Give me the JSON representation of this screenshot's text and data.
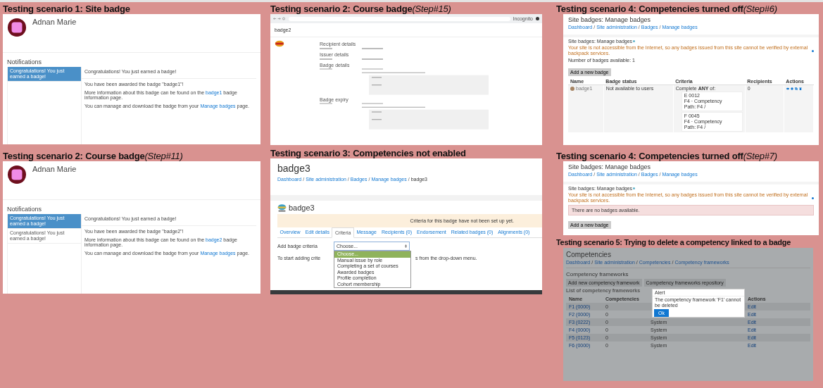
{
  "columns": [
    [
      {
        "kind": "notifications",
        "title": "Testing scenario 1: Site badge",
        "screen": {
          "user_name": "Adnan Marie",
          "heading": "Notifications",
          "items": [
            {
              "text": "Congratulations! You just earned a badge!",
              "selected": true
            }
          ],
          "subject": "Congratulations! You just earned a badge!",
          "paragraphs": [
            {
              "text": "You have been awarded the badge \"badge1\"!"
            },
            {
              "text": "More information about this badge can be found on the ",
              "link": "badge1",
              "after": " badge information page."
            },
            {
              "text": "You can manage and download the badge from your ",
              "link": "Manage badges",
              "after": " page."
            }
          ]
        }
      },
      {
        "kind": "notifications",
        "title": "Testing scenario 2: Course badge",
        "step": "(Step#11)",
        "screen": {
          "user_name": "Adnan Marie",
          "heading": "Notifications",
          "items": [
            {
              "text": "Congratulations! You just earned a badge!",
              "selected": true
            },
            {
              "text": "Congratulations! You just earned a badge!",
              "selected": false
            }
          ],
          "subject": "Congratulations! You just earned a badge!",
          "paragraphs": [
            {
              "text": "You have been awarded the badge \"badge2\"!"
            },
            {
              "text": "More information about this badge can be found on the ",
              "link": "badge2",
              "after": " badge information page."
            },
            {
              "text": "You can manage and download the badge from your ",
              "link": "Manage badges",
              "after": " page."
            }
          ]
        }
      }
    ],
    [
      {
        "kind": "badge_page",
        "title": "Testing scenario 2: Course badge",
        "step": "(Step#15)",
        "screen": {
          "browser_label": "Incognito",
          "page_title": "badge2",
          "sections": [
            {
              "heading": "Recipient details",
              "has_criteria": false
            },
            {
              "heading": "Issuer details",
              "has_criteria": false
            },
            {
              "heading": "Badge details",
              "has_criteria": true
            },
            {
              "heading": "Badge expiry",
              "has_criteria": true
            }
          ]
        }
      },
      {
        "kind": "criteria",
        "title": "Testing scenario 3: Competencies not enabled",
        "screen": {
          "page_title": "badge3",
          "breadcrumbs": [
            "Dashboard",
            "Site administration",
            "Badges",
            "Manage badges",
            "badge3"
          ],
          "separator": "/",
          "badge_name": "badge3",
          "notice": "Criteria for this badge have not been set up yet.",
          "tabs": [
            {
              "label": "Overview",
              "selected": false
            },
            {
              "label": "Edit details",
              "selected": false
            },
            {
              "label": "Criteria",
              "selected": true
            },
            {
              "label": "Message",
              "selected": false
            },
            {
              "label": "Recipients (0)",
              "selected": false
            },
            {
              "label": "Endorsement",
              "selected": false
            },
            {
              "label": "Related badges (0)",
              "selected": false
            },
            {
              "label": "Alignments (0)",
              "selected": false
            }
          ],
          "field_label": "Add badge criteria",
          "select_value": "Choose...",
          "options": [
            {
              "label": "Choose...",
              "selected": true
            },
            {
              "label": "Manual issue by role",
              "selected": false
            },
            {
              "label": "Completing a set of courses",
              "selected": false
            },
            {
              "label": "Awarded badges",
              "selected": false
            },
            {
              "label": "Profile completion",
              "selected": false
            },
            {
              "label": "Cohort membership",
              "selected": false
            }
          ],
          "hint_start": "To start adding crite",
          "hint_end": "s from the drop-down menu."
        }
      }
    ],
    [
      {
        "kind": "manage_badges",
        "title": "Testing scenario 4: Competencies turned off",
        "step": "(Step#6)",
        "screen": {
          "page_title": "Site badges: Manage badges",
          "breadcrumbs": [
            "Dashboard",
            "Site administration",
            "Badges",
            "Manage badges"
          ],
          "separator": "/",
          "heading": "Site badges: Manage badges",
          "warning": "Your site is not accessible from the Internet, so any badges issued from this site cannot be verified by external backpack services.",
          "count": "Number of badges available: 1",
          "button": "Add a new badge",
          "columns": [
            "Name",
            "Badge status",
            "Criteria",
            "Recipients",
            "Actions"
          ],
          "rows": [
            {
              "name": "badge1",
              "status": "Not available to users",
              "criteria_intro": "Complete **ANY** of:",
              "competencies": [
                {
                  "name": "E 0012",
                  "type": "F4 · Competency",
                  "path": "Path: F4 /"
                },
                {
                  "name": "F 0045",
                  "type": "F4 · Competency",
                  "path": "Path: F4 /"
                }
              ],
              "recipients": "0"
            }
          ]
        }
      },
      {
        "kind": "manage_badges",
        "title": "Testing scenario 4: Competencies turned off",
        "step": "(Step#7)",
        "screen": {
          "page_title": "Site badges: Manage badges",
          "breadcrumbs": [
            "Dashboard",
            "Site administration",
            "Badges",
            "Manage badges"
          ],
          "separator": "/",
          "heading": "Site badges: Manage badges",
          "warning": "Your site is not accessible from the Internet, so any badges issued from this site cannot be verified by external backpack services.",
          "empty_notice": "There are no badges available.",
          "button": "Add a new badge"
        }
      },
      {
        "kind": "competencies",
        "title": "Testing scenario 5: Trying to delete a competency linked to a badge",
        "screen": {
          "page_title": "Competencies",
          "breadcrumbs": [
            "Dashboard",
            "Site administration",
            "Competencies",
            "Competency frameworks"
          ],
          "separator": "/",
          "heading": "Competency frameworks",
          "buttons": [
            "Add new competency framework",
            "Competency frameworks repository"
          ],
          "list_heading": "List of competency frameworks",
          "columns": [
            "Name",
            "Competencies",
            "Actions"
          ],
          "rows": [
            {
              "name": "F1 (0000)",
              "count": "0",
              "action": "Edit"
            },
            {
              "name": "F2 (0000)",
              "count": "0",
              "action": "Edit"
            },
            {
              "name": "F3 (0222)",
              "count": "0",
              "category": "System",
              "action": "Edit"
            },
            {
              "name": "F4 (0000)",
              "count": "0",
              "category": "System",
              "action": "Edit"
            },
            {
              "name": "F5 (0123)",
              "count": "0",
              "category": "System",
              "action": "Edit"
            },
            {
              "name": "F6 (0000)",
              "count": "0",
              "category": "System",
              "action": "Edit"
            }
          ],
          "modal": {
            "title": "Alert",
            "message": "The competency framework 'F1' cannot be deleted",
            "button": "Ok"
          }
        }
      }
    ]
  ]
}
